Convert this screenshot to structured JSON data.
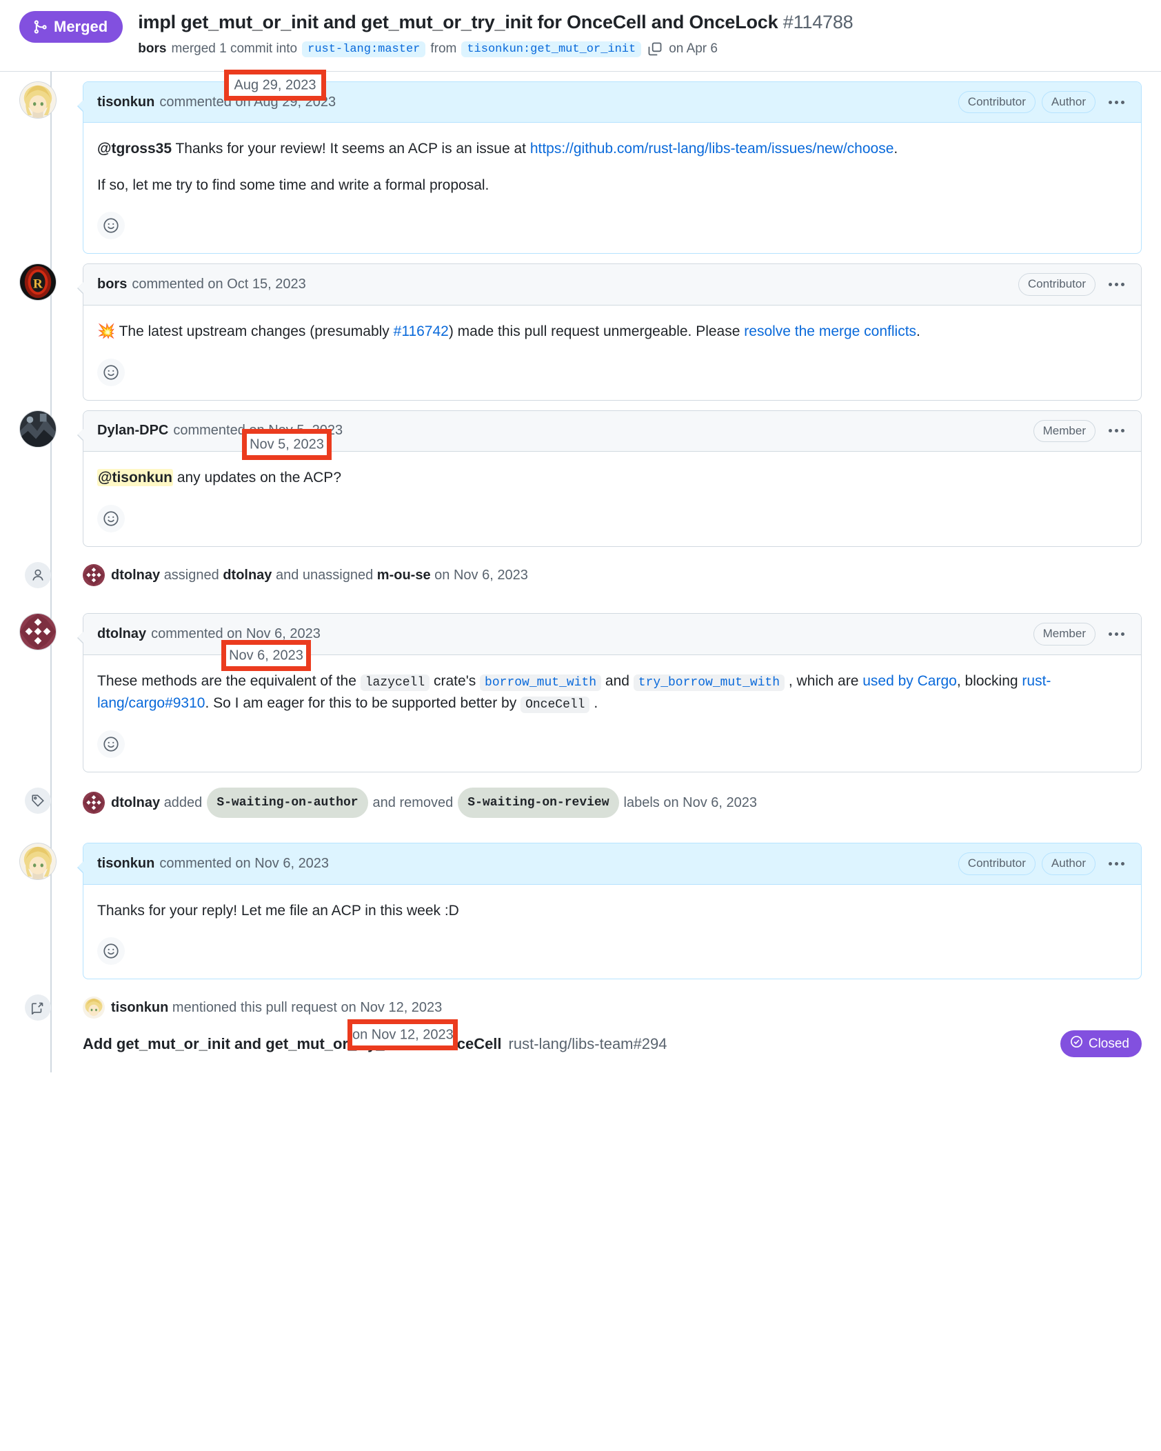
{
  "header": {
    "status_label": "Merged",
    "status_icon": "git-merge-icon",
    "status_color": "#8250df",
    "title": "impl get_mut_or_init and get_mut_or_try_init for OnceCell and OnceLock",
    "number": "#114788",
    "merger": "bors",
    "merged_text": "merged 1 commit into",
    "base_branch": "rust-lang:master",
    "from_text": "from",
    "head_branch": "tisonkun:get_mut_or_init",
    "copy_icon": "copy-icon",
    "merged_date": "on Apr 6"
  },
  "comments": [
    {
      "author": "tisonkun",
      "commented_text": "commented on",
      "date": "Aug 29, 2023",
      "badges": [
        "Contributor",
        "Author"
      ],
      "is_author": true,
      "avatar": "tisonkun-avatar",
      "body_html": "<p><b>@tgross35</b> Thanks for your review! It seems an ACP is an issue at <a href=\"#\">https://github.com/rust-lang/libs-team/issues/new/choose</a>.</p><p>If so, let me try to find some time and write a formal proposal.</p>",
      "reaction_icon": "smiley-reaction-icon"
    },
    {
      "author": "bors",
      "commented_text": "commented on",
      "date": "Oct 15, 2023",
      "badges": [
        "Contributor"
      ],
      "is_author": false,
      "avatar": "bors-avatar",
      "body_html": "<p>💥 The latest upstream changes (presumably <a href=\"#\">#116742</a>) made this pull request unmergeable. Please <a href=\"#\">resolve the merge conflicts</a>.</p>",
      "reaction_icon": "smiley-reaction-icon"
    },
    {
      "author": "Dylan-DPC",
      "commented_text": "commented on",
      "date": "Nov 5, 2023",
      "badges": [
        "Member"
      ],
      "is_author": false,
      "avatar": "dylan-dpc-avatar",
      "body_html": "<p><span class=\"mention-hl\">@tisonkun</span> any updates on the ACP?</p>",
      "reaction_icon": "smiley-reaction-icon"
    },
    {
      "author": "dtolnay",
      "commented_text": "commented on",
      "date": "Nov 6, 2023",
      "badges": [
        "Member"
      ],
      "is_author": false,
      "avatar": "dtolnay-avatar",
      "body_html": "<p>These methods are the equivalent of the <code class=\"inline\">lazycell</code> crate's <code class=\"inline link\">borrow_mut_with</code> and <code class=\"inline link\">try_borrow_mut_with</code> , which are <a href=\"#\">used by Cargo</a>, blocking <a href=\"#\">rust-lang/cargo#9310</a>. So I am eager for this to be supported better by <code class=\"inline\">OnceCell</code> .</p>",
      "reaction_icon": "smiley-reaction-icon"
    },
    {
      "author": "tisonkun",
      "commented_text": "commented on",
      "date": "Nov 6, 2023",
      "badges": [
        "Contributor",
        "Author"
      ],
      "is_author": true,
      "avatar": "tisonkun-avatar",
      "body_html": "<p>Thanks for your reply! Let me file an ACP in this week :D</p>",
      "reaction_icon": "smiley-reaction-icon"
    }
  ],
  "events": {
    "assigned": {
      "icon": "person-icon",
      "avatar": "dtolnay-avatar",
      "actor": "dtolnay",
      "verb_1": "assigned",
      "target_1": "dtolnay",
      "verb_2": "and unassigned",
      "target_2": "m-ou-se",
      "date": "on Nov 6, 2023"
    },
    "labeled": {
      "icon": "tag-icon",
      "avatar": "dtolnay-avatar",
      "actor": "dtolnay",
      "verb_1": "added",
      "label_added": "S-waiting-on-author",
      "verb_2": "and removed",
      "label_removed": "S-waiting-on-review",
      "suffix": "labels on Nov 6, 2023"
    },
    "mentioned": {
      "icon": "cross-reference-icon",
      "avatar": "tisonkun-avatar",
      "actor": "tisonkun",
      "verb": "mentioned this pull request",
      "date": "on Nov 12, 2023",
      "xref_title": "Add get_mut_or_init and get_mut_or_try_init for OnceCell",
      "xref_repo": "rust-lang/libs-team#294",
      "xref_status": "Closed",
      "xref_status_icon": "check-circle-icon",
      "xref_status_color": "#8250df"
    }
  },
  "annotations": [
    {
      "name": "annotation-aug-29-2023",
      "text": "Aug 29, 2023"
    },
    {
      "name": "annotation-nov-5-2023",
      "text": "Nov 5, 2023"
    },
    {
      "name": "annotation-nov-6-2023",
      "text": "Nov 6, 2023"
    },
    {
      "name": "annotation-nov-12-2023",
      "text": "on Nov 12, 2023"
    }
  ]
}
